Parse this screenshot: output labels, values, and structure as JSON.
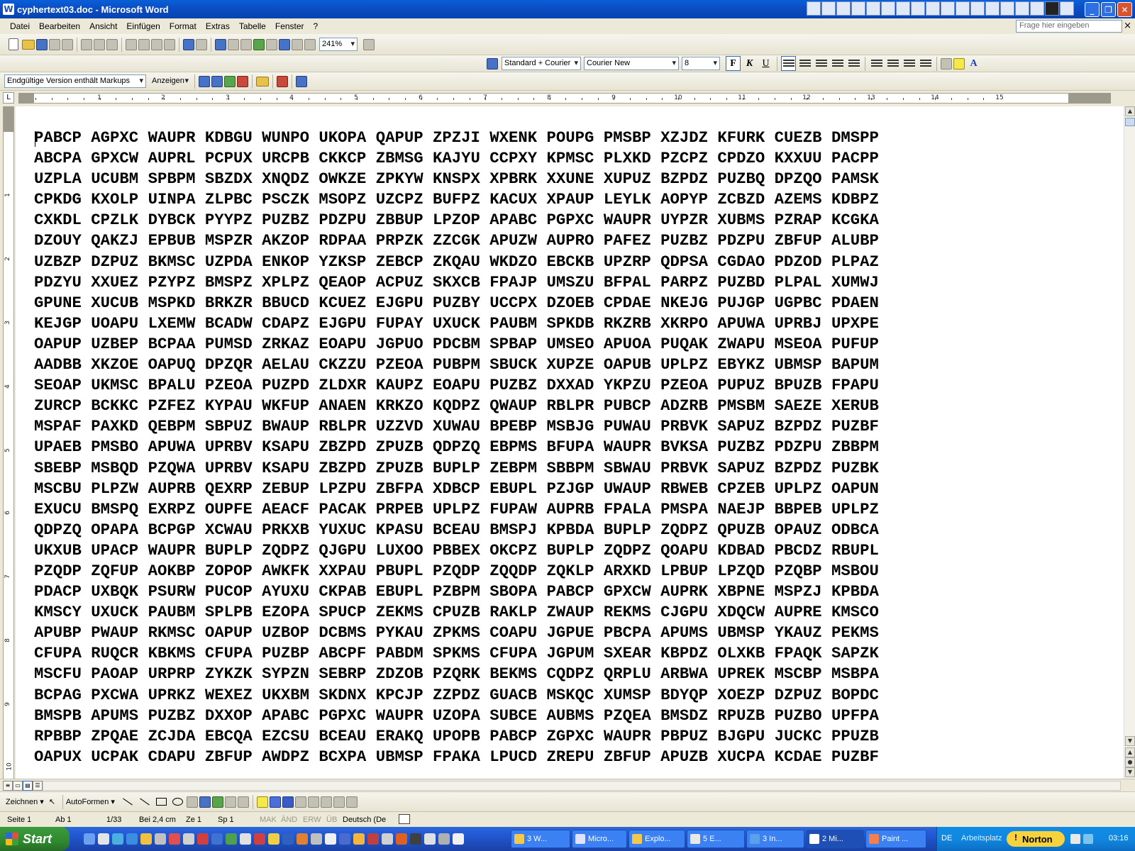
{
  "window": {
    "title": "cyphertext03.doc - Microsoft Word"
  },
  "menu": {
    "items": [
      "Datei",
      "Bearbeiten",
      "Ansicht",
      "Einfügen",
      "Format",
      "Extras",
      "Tabelle",
      "Fenster",
      "?"
    ],
    "help_placeholder": "Frage hier eingeben",
    "help_close": "×"
  },
  "toolbar": {
    "zoom": "241%",
    "style": "Standard + Courier",
    "font": "Courier New",
    "size": "8",
    "bold": "F",
    "italic": "K",
    "underline": "U",
    "font_color_label": "A"
  },
  "review": {
    "markup_mode": "Endgültige Version enthält Markups",
    "show_label": "Anzeigen"
  },
  "ruler": {
    "numbers": [
      "1",
      "2",
      "3",
      "4",
      "5",
      "6",
      "7",
      "8",
      "9",
      "10",
      "11",
      "12",
      "13",
      "14",
      "15"
    ]
  },
  "vruler": {
    "numbers": [
      "1",
      "2",
      "3",
      "4",
      "5",
      "6",
      "7",
      "8",
      "9",
      "10"
    ]
  },
  "document": {
    "lines": [
      "PABCP AGPXC WAUPR KDBGU WUNPO UKOPA QAPUP ZPZJI WXENK POUPG PMSBP XZJDZ KFURK CUEZB DMSPP",
      "ABCPA GPXCW AUPRL PCPUX URCPB CKKCP ZBMSG KAJYU CCPXY KPMSC PLXKD PZCPZ CPDZO KXXUU PACPP",
      "UZPLA UCUBM SPBPM SBZDX XNQDZ OWKZE ZPKYW KNSPX XPBRK XXUNE XUPUZ BZPDZ PUZBQ DPZQO PAMSK",
      "CPKDG KXOLP UINPA ZLPBC PSCZK MSOPZ UZCPZ BUFPZ KACUX XPAUP LEYLK AOPYP ZCBZD AZEMS KDBPZ",
      "CXKDL CPZLK DYBCK PYYPZ PUZBZ PDZPU ZBBUP LPZOP APABC PGPXC WAUPR UYPZR XUBMS PZRAP KCGKA",
      "DZOUY QAKZJ EPBUB MSPZR AKZOP RDPAA PRPZK ZZCGK APUZW AUPRO PAFEZ PUZBZ PDZPU ZBFUP ALUBP",
      "UZBZP DZPUZ BKMSC UZPDA ENKOP YZKSP ZEBCP ZKQAU WKDZO EBCKB UPZRP QDPSA CGDAO PDZOD PLPAZ",
      "PDZYU XXUEZ PZYPZ BMSPZ XPLPZ QEAOP ACPUZ SKXCB FPAJP UMSZU BFPAL PARPZ PUZBD PLPAL XUMWJ",
      "GPUNE XUCUB MSPKD BRKZR BBUCD KCUEZ EJGPU PUZBY UCCPX DZOEB CPDAE NKEJG PUJGP UGPBC PDAEN",
      "KEJGP UOAPU LXEMW BCADW CDAPZ EJGPU FUPAY UXUCK PAUBM SPKDB RKZRB XKRPO APUWA UPRBJ UPXPE",
      "OAPUP UZBEP BCPAA PUMSD ZRKAZ EOAPU JGPUO PDCBM SPBAP UMSEO APUOA PUQAK ZWAPU MSEOA PUFUP",
      "AADBB XKZOE OAPUQ DPZQR AELAU CKZZU PZEOA PUBPM SBUCK XUPZE OAPUB UPLPZ EBYKZ UBMSP BAPUM",
      "SEOAP UKMSC BPALU PZEOA PUZPD ZLDXR KAUPZ EOAPU PUZBZ DXXAD YKPZU PZEOA PUPUZ BPUZB FPAPU",
      "ZURCP BCKKC PZFEZ KYPAU WKFUP ANAEN KRKZO KQDPZ QWAUP RBLPR PUBCP ADZRB PMSBM SAEZE XERUB",
      "MSPAF PAXKD QEBPM SBPUZ BWAUP RBLPR UZZVD XUWAU BPEBP MSBJG PUWAU PRBVK SAPUZ BZPDZ PUZBF",
      "UPAEB PMSBO APUWA UPRBV KSAPU ZBZPD ZPUZB QDPZQ EBPMS BFUPA WAUPR BVKSA PUZBZ PDZPU ZBBPM",
      "SBEBP MSBQD PZQWA UPRBV KSAPU ZBZPD ZPUZB BUPLP ZEBPM SBBPM SBWAU PRBVK SAPUZ BZPDZ PUZBK",
      "MSCBU PLPZW AUPRB QEXRP ZEBUP LPZPU ZBFPA XDBCP EBUPL PZJGP UWAUP RBWEB CPZEB UPLPZ OAPUN",
      "EXUCU BMSPQ EXRPZ OUPFE AEACF PACAK PRPEB UPLPZ FUPAW AUPRB FPALA PMSPA NAEJP BBPEB UPLPZ",
      "QDPZQ OPAPA BCPGP XCWAU PRKXB YUXUC KPASU BCEAU BMSPJ KPBDA BUPLP ZQDPZ QPUZB OPAUZ ODBCA",
      "UKXUB UPACP WAUPR BUPLP ZQDPZ QJGPU LUXOO PBBEX OKCPZ BUPLP ZQDPZ QOAPU KDBAD PBCDZ RBUPL",
      "PZQDP ZQFUP AOKBP ZOPOP AWKFK XXPAU PBUPL PZQDP ZQQDP ZQKLP ARXKD LPBUP LPZQD PZQBP MSBOU",
      "PDACP UXBQK PSURW PUCOP AYUXU CKPAB EBUPL PZBPM SBOPA PABCP GPXCW AUPRK XBPNE MSPZJ KPBDA",
      "KMSCY UXUCK PAUBM SPLPB EZOPA SPUCP ZEKMS CPUZB RAKLP ZWAUP REKMS CJGPU XDQCW AUPRE KMSCO",
      "APUBP PWAUP RKMSC OAPUP UZBOP DCBMS PYKAU ZPKMS COAPU JGPUE PBCPA APUMS UBMSP YKAUZ PEKMS",
      "CFUPA RUQCR KBKMS CFUPA PUZBP ABCPF PABDM SPKMS CFUPA JGPUM SXEAR KBPDZ OLXKB FPAQK SAPZK",
      "MSCFU PAOAP URPRP ZYKZK SYPZN SEBRP ZDZOB PZQRK BEKMS CQDPZ QRPLU ARBWA UPREK MSCBP MSBPA",
      "BCPAG PXCWA UPRKZ WEXEZ UKXBM SKDNX KPCJP ZZPDZ GUACB MSKQC XUMSP BDYQP XOEZP DZPUZ BOPDC",
      "BMSPB APUMS PUZBZ DXXOP APABC PGPXC WAUPR UZOPA SUBCE AUBMS PZQEA BMSDZ RPUZB PUZBO UPFPA",
      "RPBBP ZPQAE ZCJDA EBCQA EZCSU BCEAU ERAKQ UPOPB PABCP ZGPXC WAUPR PBPUZ BJGPU JUCKC PPUZB",
      "OAPUX UCPAK CDAPU ZBFUP AWDPZ BCXPA UBMSP FPAKA LPUCD ZREPU ZBFUP APUZB XUCPA KCDAE PUZBF"
    ]
  },
  "drawbar": {
    "draw_label": "Zeichnen ▾",
    "autoshapes_label": "AutoFormen ▾"
  },
  "status": {
    "page": "Seite  1",
    "section": "Ab  1",
    "pages": "1/33",
    "at": "Bei  2,4 cm",
    "line": "Ze  1",
    "col": "Sp  1",
    "mak": "MAK",
    "aend": "ÄND",
    "erw": "ERW",
    "ueb": "ÜB",
    "language": "Deutsch (De"
  },
  "taskbar": {
    "start_label": "Start",
    "tasks": [
      "3 W...",
      "Micro...",
      "Explo...",
      "5 E...",
      "3 In...",
      "2 Mi...",
      "Paint ..."
    ],
    "lang": "DE",
    "arbeitsplatz": "Arbeitsplatz",
    "norton": "Norton",
    "clock": "03:16"
  }
}
